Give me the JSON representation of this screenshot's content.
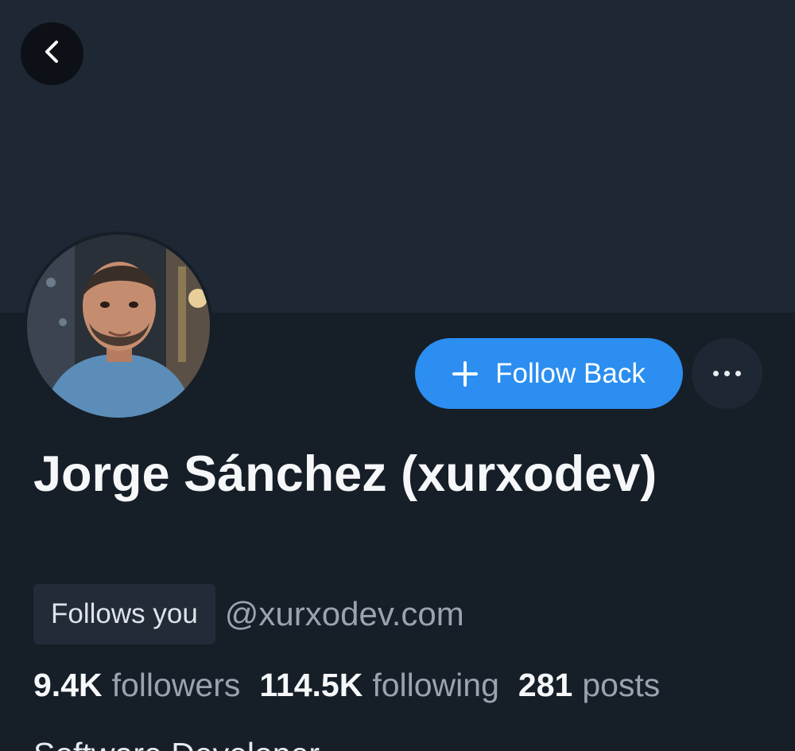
{
  "profile": {
    "display_name": "Jorge Sánchez (xurxodev)",
    "handle": "@xurxodev.com",
    "follows_you_label": "Follows you",
    "bio_preview": "Software Developer"
  },
  "actions": {
    "back_icon": "chevron-left-icon",
    "follow_back_label": "Follow Back",
    "more_icon": "ellipsis-icon"
  },
  "stats": [
    {
      "value": "9.4K",
      "label": "followers"
    },
    {
      "value": "114.5K",
      "label": "following"
    },
    {
      "value": "281",
      "label": "posts"
    }
  ],
  "colors": {
    "background": "#161e27",
    "banner": "#1e2835",
    "accent": "#2b8ef0",
    "muted_text": "#98a4b2"
  }
}
